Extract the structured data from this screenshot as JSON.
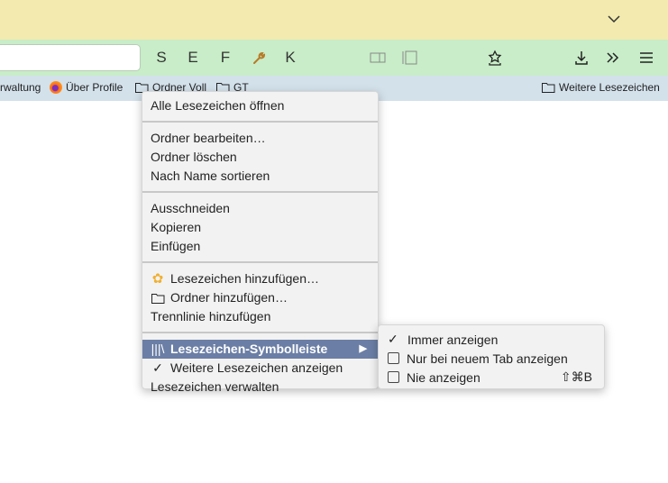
{
  "toolbar": {
    "buttons": [
      "S",
      "E",
      "F",
      "K"
    ]
  },
  "bookmarks_bar": {
    "items": [
      "rwaltung",
      "Über Profile",
      "Ordner Voll",
      "GT"
    ],
    "other": "Weitere Lesezeichen"
  },
  "menu": {
    "items": [
      "Alle Lesezeichen öffnen",
      "Ordner bearbeiten…",
      "Ordner löschen",
      "Nach Name sortieren",
      "Ausschneiden",
      "Kopieren",
      "Einfügen",
      "Lesezeichen hinzufügen…",
      "Ordner hinzufügen…",
      "Trennlinie hinzufügen",
      "Lesezeichen-Symbolleiste",
      "Weitere Lesezeichen anzeigen",
      "Lesezeichen verwalten"
    ]
  },
  "submenu": {
    "items": [
      {
        "label": "Immer anzeigen",
        "checked": true
      },
      {
        "label": "Nur bei neuem Tab anzeigen",
        "checked": false
      },
      {
        "label": "Nie anzeigen",
        "checked": false,
        "shortcut": "⇧⌘B"
      }
    ]
  },
  "colors": {
    "highlight": "#6b7ea5",
    "toolbar": "#c8edc8",
    "titlebar": "#f2eaae",
    "bookmarks": "#d3e1eb"
  }
}
